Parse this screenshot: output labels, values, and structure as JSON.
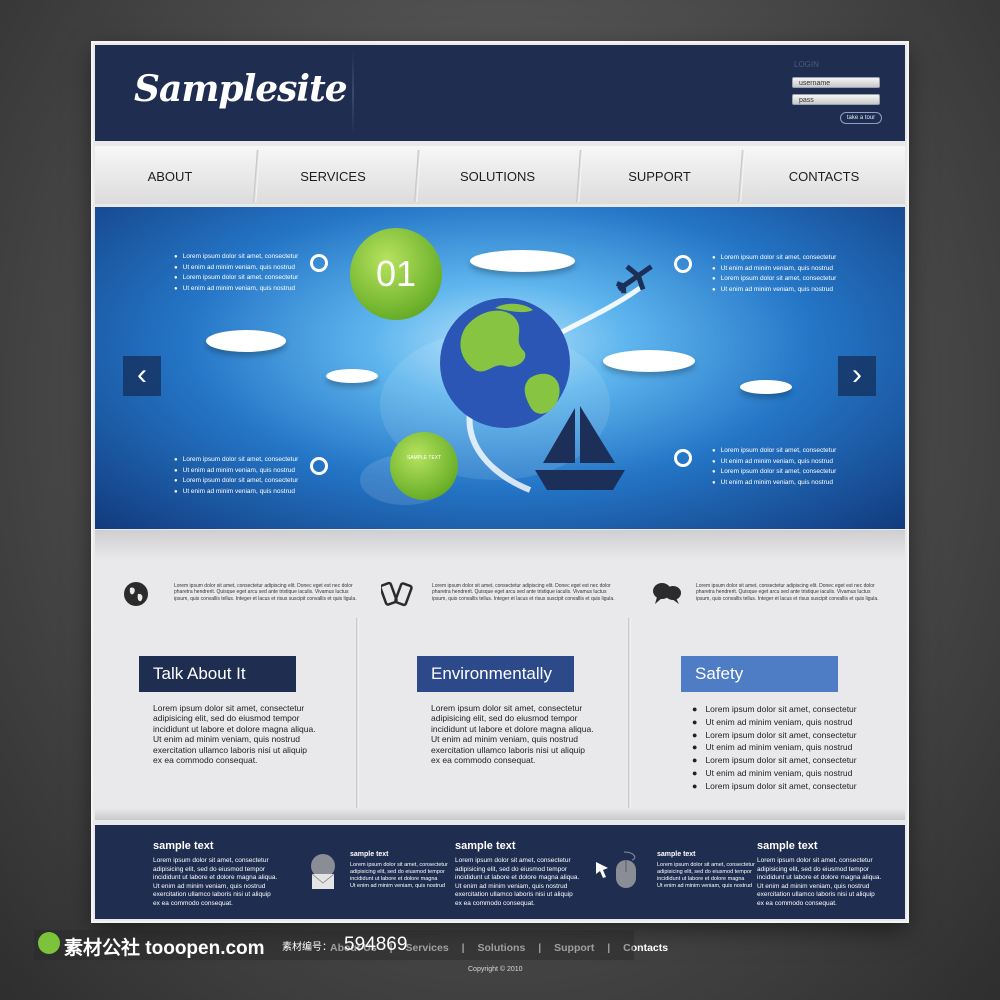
{
  "header": {
    "logo": "Samplesite",
    "login_label": "LOGIN",
    "username_placeholder": "username",
    "password_placeholder": "pass",
    "tour_label": "take a tour"
  },
  "nav": {
    "items": [
      {
        "label": "ABOUT"
      },
      {
        "label": "SERVICES"
      },
      {
        "label": "SOLUTIONS"
      },
      {
        "label": "SUPPORT"
      },
      {
        "label": "CONTACTS"
      }
    ]
  },
  "hero": {
    "badge_number": "01",
    "badge_sample": "SAMPLE TEXT",
    "prev_arrow": "‹",
    "next_arrow": "›",
    "lists": [
      [
        "Lorem ipsum dolor sit amet, consectetur",
        "Ut enim ad minim veniam, quis nostrud",
        "Lorem ipsum dolor sit amet, consectetur",
        "Ut enim ad minim veniam, quis nostrud"
      ],
      [
        "Lorem ipsum dolor sit amet, consectetur",
        "Ut enim ad minim veniam, quis nostrud",
        "Lorem ipsum dolor sit amet, consectetur",
        "Ut enim ad minim veniam, quis nostrud"
      ],
      [
        "Lorem ipsum dolor sit amet, consectetur",
        "Ut enim ad minim veniam, quis nostrud",
        "Lorem ipsum dolor sit amet, consectetur",
        "Ut enim ad minim veniam, quis nostrud"
      ],
      [
        "Lorem ipsum dolor sit amet, consectetur",
        "Ut enim ad minim veniam, quis nostrud",
        "Lorem ipsum dolor sit amet, consectetur",
        "Ut enim ad minim veniam, quis nostrud"
      ]
    ]
  },
  "features": [
    {
      "icon": "globe-icon",
      "text": "Lorem ipsum dolor sit amet, consectetur adipiscing elit. Donec eget est nec dolor pharetra hendrerit. Quisque eget arcu sed ante tristique iaculis. Vivamus luctus ipsum, quis convallis tellus. Integer et lacus et risus suscipit convallis et quis ligula."
    },
    {
      "icon": "phones-icon",
      "text": "Lorem ipsum dolor sit amet, consectetur adipiscing elit. Donec eget est nec dolor pharetra hendrerit. Quisque eget arcu sed ante tristique iaculis. Vivamus luctus ipsum, quis convallis tellus. Integer et lacus et risus suscipit convallis et quis ligula."
    },
    {
      "icon": "chat-bubbles-icon",
      "text": "Lorem ipsum dolor sit amet, consectetur adipiscing elit. Donec eget est nec dolor pharetra hendrerit. Quisque eget arcu sed ante tristique iaculis. Vivamus luctus ipsum, quis convallis tellus. Integer et lacus et risus suscipit convallis et quis ligula."
    }
  ],
  "columns": {
    "col1_title": "Talk About It",
    "col2_title": "Environmentally",
    "col3_title": "Safety",
    "body_lines": [
      "Lorem ipsum dolor sit amet, consectetur",
      "adipisicing elit, sed do eiusmod tempor",
      "incididunt ut labore et dolore magna aliqua.",
      "Ut enim ad minim veniam, quis nostrud",
      "exercitation ullamco laboris nisi ut aliquip",
      "ex ea commodo consequat."
    ],
    "safety_items": [
      "Lorem ipsum dolor sit amet, consectetur",
      "Ut enim ad minim veniam, quis nostrud",
      "Lorem ipsum dolor sit amet, consectetur",
      "Ut enim ad minim veniam, quis nostrud",
      "Lorem ipsum dolor sit amet, consectetur",
      "Ut enim ad minim veniam, quis nostrud",
      "Lorem ipsum dolor sit amet, consectetur"
    ],
    "colors": {
      "col1": "#1f2d50",
      "col2": "#2c4a8a",
      "col3": "#4e7dc6"
    }
  },
  "footer_band": {
    "big_title": "sample text",
    "small_title": "sample text",
    "big_lines": [
      "Lorem ipsum dolor sit amet, consectetur",
      "adipisicing elit, sed do eiusmod tempor",
      "incididunt ut labore et dolore magna aliqua.",
      "Ut enim ad minim veniam, quis nostrud",
      "exercitation ullamco laboris nisi ut aliquip",
      "ex ea commodo consequat."
    ],
    "small_lines": [
      "Lorem ipsum dolor sit amet, consectetur",
      "adipisicing elit, sed do eiusmod tempor",
      "incididunt ut labore et dolore magna",
      "Ut enim ad minim veniam, quis nostrud"
    ]
  },
  "bottom_links": [
    "About Us",
    "Services",
    "Solutions",
    "Support",
    "Contacts"
  ],
  "copyright": "Copyright © 2010",
  "watermark": {
    "site": "素材公社 tooopen.com",
    "code_label": "素材编号：",
    "code": "594869"
  }
}
